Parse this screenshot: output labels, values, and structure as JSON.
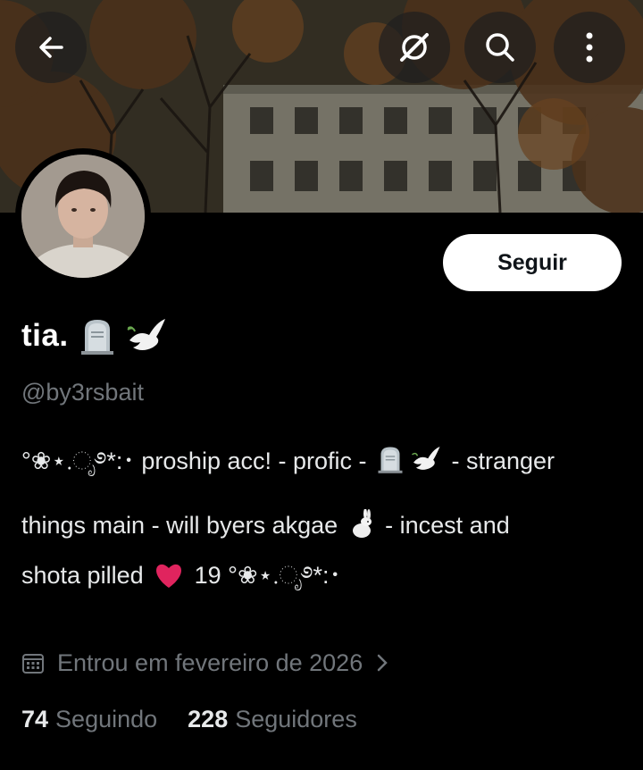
{
  "header": {
    "back_icon": "arrow-left-icon",
    "grok_icon": "grok-slash-icon",
    "search_icon": "search-icon",
    "more_icon": "more-vertical-icon"
  },
  "profile": {
    "follow_label": "Seguir",
    "display_name": "tia.",
    "name_emojis": [
      "headstone-emoji",
      "dove-emoji"
    ],
    "handle": "@by3rsbait",
    "bio": {
      "line1_prefix": "°❀⋆.ೃ࿔*:･",
      "line1_text_a": " proship acc! - profic - ",
      "line1_text_b": " - stranger",
      "line2_text_a": "things main - will byers akgae ",
      "line2_text_b": " - incest and",
      "line3_text_a": "shota pilled ",
      "line3_text_b": " 19 °❀⋆.ೃ࿔*:･"
    },
    "joined": "Entrou em fevereiro de 2026",
    "following_count": "74",
    "following_label": "Seguindo",
    "followers_count": "228",
    "followers_label": "Seguidores"
  },
  "colors": {
    "background": "#000000",
    "text_primary": "#e7e9ea",
    "text_secondary": "#71767b",
    "follow_button_bg": "#ffffff",
    "heart": "#e0245e"
  }
}
